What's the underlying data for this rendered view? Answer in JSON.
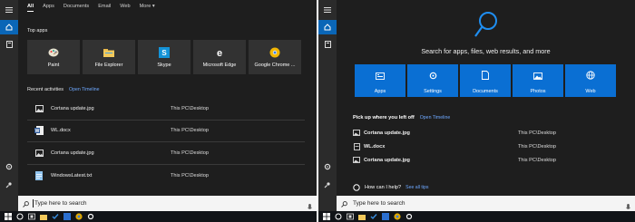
{
  "left": {
    "tabs": [
      {
        "label": "All",
        "active": true
      },
      {
        "label": "Apps"
      },
      {
        "label": "Documents"
      },
      {
        "label": "Email"
      },
      {
        "label": "Web"
      },
      {
        "label": "More"
      }
    ],
    "top_apps_title": "Top apps",
    "top_apps": [
      {
        "label": "Paint",
        "icon": "paint-icon"
      },
      {
        "label": "File Explorer",
        "icon": "folder-icon"
      },
      {
        "label": "Skype",
        "icon": "skype-icon"
      },
      {
        "label": "Microsoft Edge",
        "icon": "edge-icon"
      },
      {
        "label": "Google Chrome ...",
        "icon": "chrome-icon"
      }
    ],
    "recent_title": "Recent activities",
    "open_timeline": "Open Timeline",
    "recent": [
      {
        "name": "Cortana update.jpg",
        "path": "This PC\\Desktop",
        "icon": "image-icon"
      },
      {
        "name": "WL.docx",
        "path": "This PC\\Desktop",
        "icon": "word-icon"
      },
      {
        "name": "Cortana update.jpg",
        "path": "This PC\\Desktop",
        "icon": "image-icon"
      },
      {
        "name": "WindowsLatest.txt",
        "path": "This PC\\Desktop",
        "icon": "text-file-icon"
      }
    ],
    "search_placeholder": "Type here to search"
  },
  "right": {
    "headline": "Search for apps, files, web results, and more",
    "categories": [
      {
        "label": "Apps",
        "icon": "apps-icon"
      },
      {
        "label": "Settings",
        "icon": "settings-icon"
      },
      {
        "label": "Documents",
        "icon": "document-icon"
      },
      {
        "label": "Photos",
        "icon": "photo-icon"
      },
      {
        "label": "Web",
        "icon": "globe-icon"
      }
    ],
    "pickup_title": "Pick up where you left off",
    "open_timeline": "Open Timeline",
    "recent": [
      {
        "name": "Cortana update.jpg",
        "path": "This PC\\Desktop"
      },
      {
        "name": "WL.docx",
        "path": "This PC\\Desktop"
      },
      {
        "name": "Cortana update.jpg",
        "path": "This PC\\Desktop"
      }
    ],
    "help_title": "How can I help?",
    "see_all_tips": "See all tips",
    "search_placeholder": "Type here to search"
  },
  "colors": {
    "panel_bg": "#1e1e1e",
    "rail_bg": "#2b2b2b",
    "accent": "#0a66b7",
    "category_blue": "#0a6fd3",
    "link": "#6ea8ff"
  }
}
